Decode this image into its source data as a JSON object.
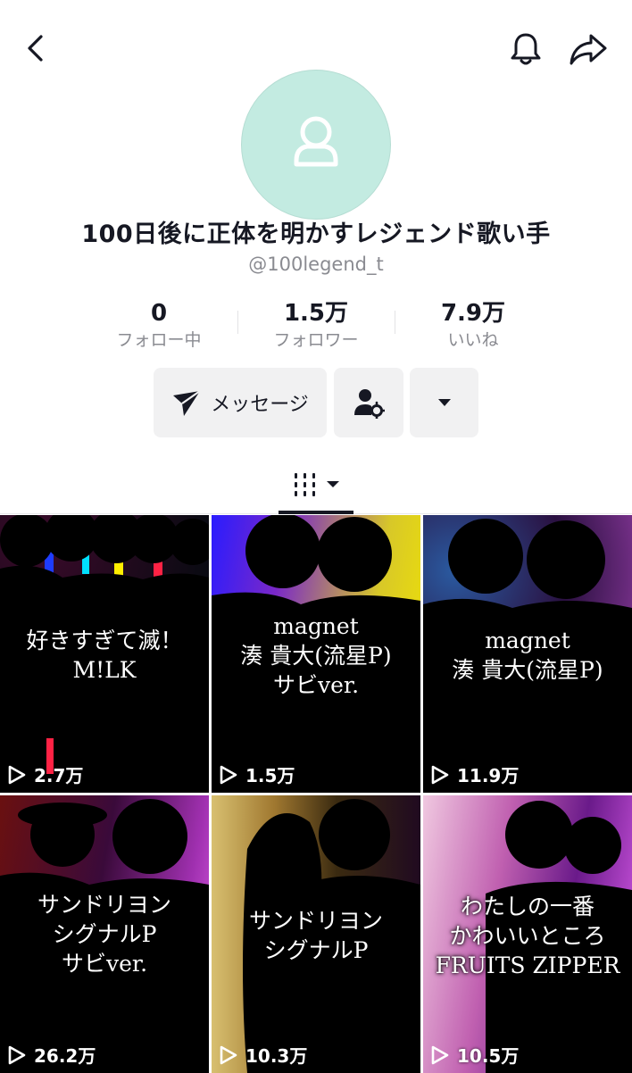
{
  "profile": {
    "display_name": "100日後に正体を明かすレジェンド歌い手",
    "username": "@100legend_t"
  },
  "stats": [
    {
      "value": "0",
      "label": "フォロー中"
    },
    {
      "value": "1.5万",
      "label": "フォロワー"
    },
    {
      "value": "7.9万",
      "label": "いいね"
    }
  ],
  "actions": {
    "message_label": "メッセージ"
  },
  "colors": {
    "avatar_bg": "#c3ebe1",
    "button_bg": "#f1f1f2",
    "text_primary": "#161823",
    "text_secondary": "#8a8b91"
  },
  "icons": {
    "back": "chevron-left-icon",
    "bell": "bell-icon",
    "share": "share-arrow-icon",
    "message": "paper-plane-icon",
    "friend_settings": "user-gear-icon",
    "more": "caret-down-icon",
    "grid_tab": "grid-bars-icon",
    "views": "play-icon"
  },
  "videos": [
    {
      "caption": "好きすぎて滅！\nM!LK",
      "views": "2.7万"
    },
    {
      "caption": "magnet\n湊 貴大(流星P)\nサビver.",
      "views": "1.5万"
    },
    {
      "caption": "magnet\n湊 貴大(流星P)",
      "views": "11.9万"
    },
    {
      "caption": "サンドリヨン\nシグナルP\nサビver.",
      "views": "26.2万"
    },
    {
      "caption": "サンドリヨン\nシグナルP",
      "views": "10.3万"
    },
    {
      "caption": "わたしの一番\nかわいいところ\nFRUITS ZIPPER",
      "views": "10.5万"
    }
  ]
}
